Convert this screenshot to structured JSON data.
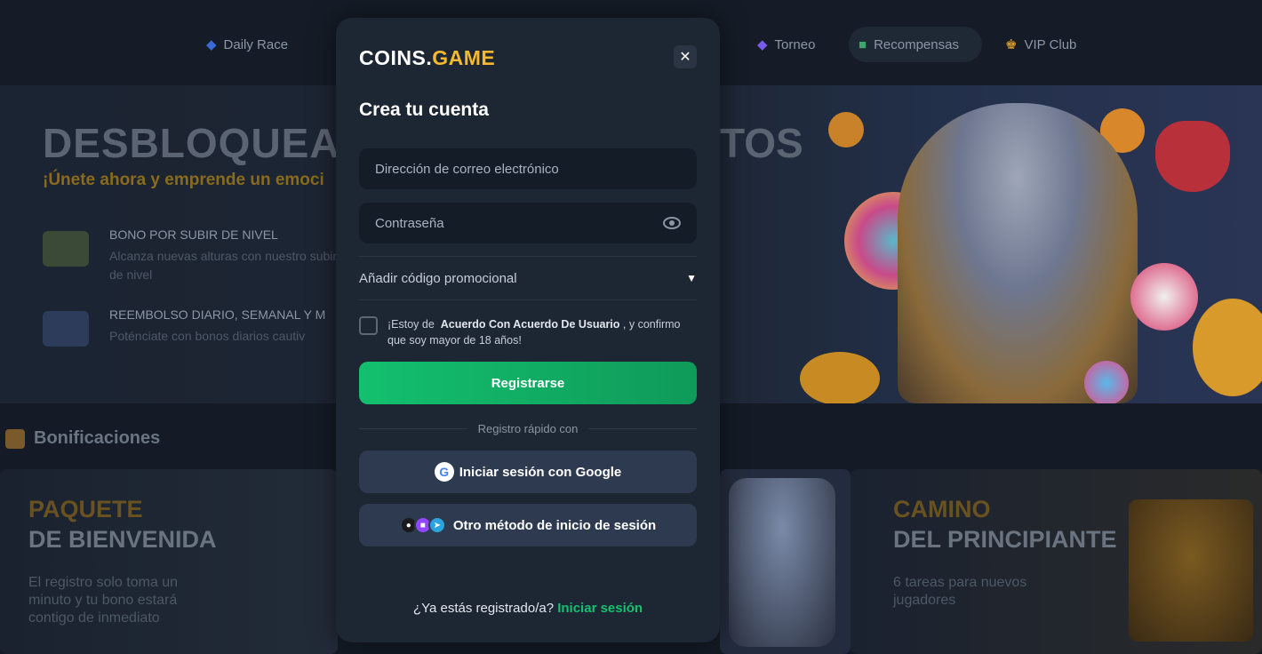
{
  "nav": {
    "items": [
      {
        "label": "Daily Race",
        "icon": "trophy-icon",
        "color": "#3a6ad8"
      },
      {
        "label": "Torneo",
        "icon": "diamond-icon",
        "color": "#7a5ae8"
      },
      {
        "label": "Recompensas",
        "icon": "gift-icon",
        "color": "#3aa86a"
      },
      {
        "label": "VIP Club",
        "icon": "crown-icon",
        "color": "#d89a2a"
      }
    ]
  },
  "hero": {
    "title_left": "DESBLOQUEA",
    "title_right": "TOS",
    "subtitle": "¡Únete ahora y emprende un emoci",
    "perks": [
      {
        "title": "BONO POR SUBIR DE NIVEL",
        "desc": "Alcanza nuevas alturas con nuestro subir de nivel"
      },
      {
        "title": "REEMBOLSO DIARIO, SEMANAL Y M",
        "desc": "Poténciate con bonos diarios cautiv"
      }
    ]
  },
  "bonuses": {
    "heading": "Bonificaciones",
    "cards": [
      {
        "title_gold": "PAQUETE",
        "title_white": "DE BIENVENIDA",
        "desc": "El registro solo toma un minuto y tu bono estará contigo de inmediato"
      },
      {
        "title_gold": "CAMINO",
        "title_white": "DEL PRINCIPIANTE",
        "desc": "6 tareas para nuevos jugadores"
      }
    ]
  },
  "modal": {
    "logo_part1": "COINS.",
    "logo_part2": "GAME",
    "close_label": "✕",
    "title": "Crea tu cuenta",
    "email_placeholder": "Dirección de correo electrónico",
    "password_placeholder": "Contraseña",
    "promo_label": "Añadir código promocional",
    "agree_prefix": "¡Estoy de",
    "agree_bold": "Acuerdo Con Acuerdo De Usuario",
    "agree_suffix": ", y confirmo que soy mayor de 18 años!",
    "register_label": "Registrarse",
    "quick_label": "Registro rápido con",
    "google_label": "Iniciar sesión con Google",
    "other_label": "Otro método de inicio de sesión",
    "already_label": "¿Ya estás registrado/a?",
    "signin_label": "Iniciar sesión"
  },
  "colors": {
    "accent_green": "#13c06e",
    "logo_gold": "#f5b82e"
  }
}
